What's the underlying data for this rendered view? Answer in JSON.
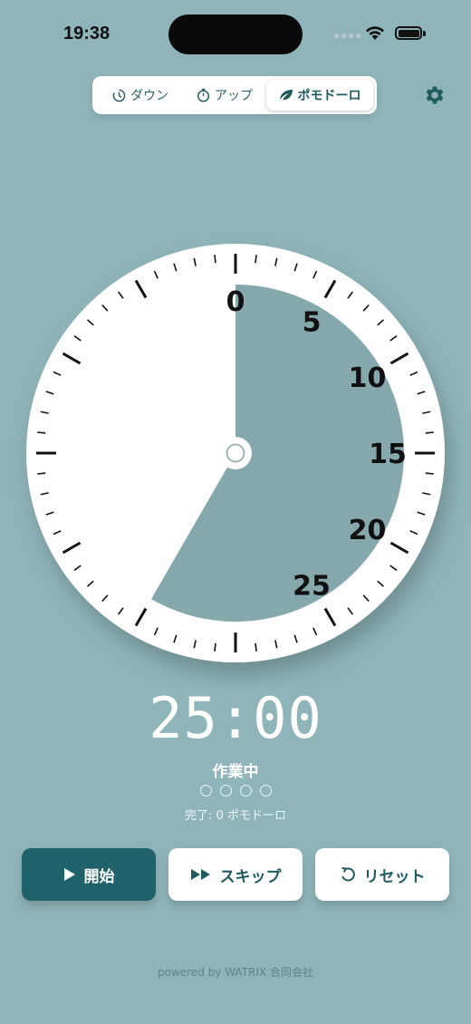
{
  "status_bar": {
    "time": "19:38"
  },
  "modes": [
    {
      "label": "ダウン",
      "icon": "timer-countdown-icon",
      "active": false
    },
    {
      "label": "アップ",
      "icon": "stopwatch-icon",
      "active": false
    },
    {
      "label": "ポモドーロ",
      "icon": "leaf-icon",
      "active": true
    }
  ],
  "dial": {
    "labels": [
      "0",
      "5",
      "10",
      "15",
      "20",
      "25"
    ],
    "total_minutes": 60,
    "remaining_minutes": 25,
    "colors": {
      "face": "#ffffff",
      "remaining": "#85a8ac",
      "ticks": "#111111"
    }
  },
  "timer": {
    "display": "25:00",
    "phase": "作業中",
    "session_dots": 4,
    "completed_text": "完了: 0 ポモドーロ"
  },
  "buttons": {
    "start": "開始",
    "skip": "スキップ",
    "reset": "リセット"
  },
  "footer": "powered by WATRIX 合同会社",
  "colors": {
    "background": "#8fb5ba",
    "accent": "#20626a"
  }
}
